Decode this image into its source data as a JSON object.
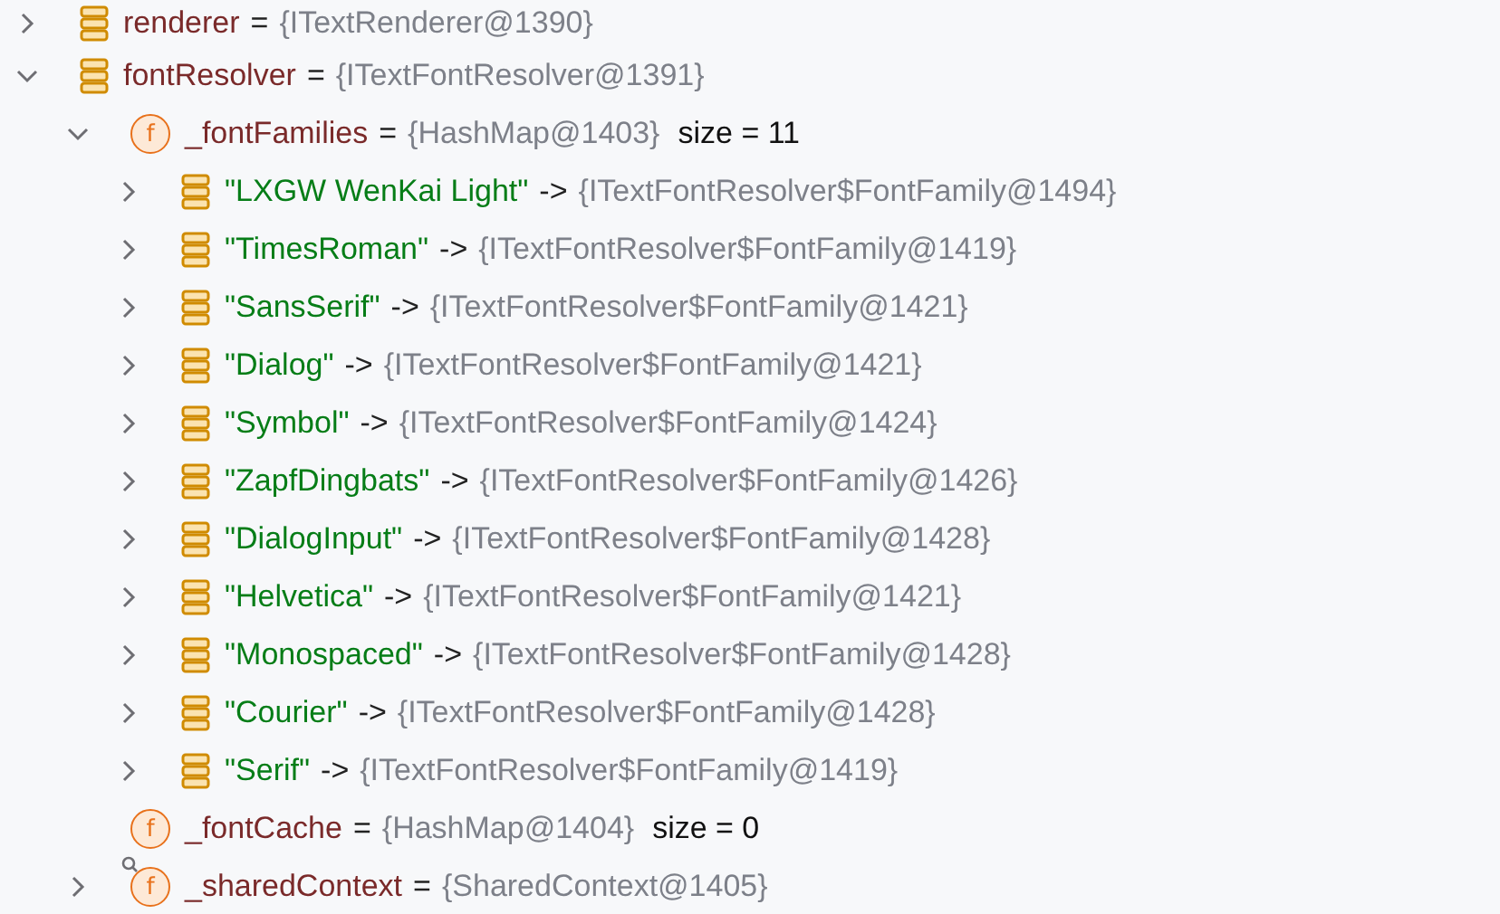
{
  "variables": [
    {
      "name": "renderer",
      "separator": "=",
      "value": "{ITextRenderer@1390}",
      "expanded": false
    },
    {
      "name": "fontResolver",
      "separator": "=",
      "value": "{ITextFontResolver@1391}",
      "expanded": true,
      "children": [
        {
          "name": "_fontFamilies",
          "separator": "=",
          "value": "{HashMap@1403}",
          "size": "size = 11",
          "kind": "field",
          "badge": "f",
          "expanded": true,
          "children": [
            {
              "key": "\"LXGW WenKai Light\"",
              "separator": "->",
              "value": "{ITextFontResolver$FontFamily@1494}",
              "expanded": false
            },
            {
              "key": "\"TimesRoman\"",
              "separator": "->",
              "value": "{ITextFontResolver$FontFamily@1419}",
              "expanded": false
            },
            {
              "key": "\"SansSerif\"",
              "separator": "->",
              "value": "{ITextFontResolver$FontFamily@1421}",
              "expanded": false
            },
            {
              "key": "\"Dialog\"",
              "separator": "->",
              "value": "{ITextFontResolver$FontFamily@1421}",
              "expanded": false
            },
            {
              "key": "\"Symbol\"",
              "separator": "->",
              "value": "{ITextFontResolver$FontFamily@1424}",
              "expanded": false
            },
            {
              "key": "\"ZapfDingbats\"",
              "separator": "->",
              "value": "{ITextFontResolver$FontFamily@1426}",
              "expanded": false
            },
            {
              "key": "\"DialogInput\"",
              "separator": "->",
              "value": "{ITextFontResolver$FontFamily@1428}",
              "expanded": false
            },
            {
              "key": "\"Helvetica\"",
              "separator": "->",
              "value": "{ITextFontResolver$FontFamily@1421}",
              "expanded": false
            },
            {
              "key": "\"Monospaced\"",
              "separator": "->",
              "value": "{ITextFontResolver$FontFamily@1428}",
              "expanded": false
            },
            {
              "key": "\"Courier\"",
              "separator": "->",
              "value": "{ITextFontResolver$FontFamily@1428}",
              "expanded": false
            },
            {
              "key": "\"Serif\"",
              "separator": "->",
              "value": "{ITextFontResolver$FontFamily@1419}",
              "expanded": false
            }
          ]
        },
        {
          "name": "_fontCache",
          "separator": "=",
          "value": "{HashMap@1404}",
          "size": "size = 0",
          "kind": "field",
          "badge": "f"
        },
        {
          "name": "_sharedContext",
          "separator": "=",
          "value": "{SharedContext@1405}",
          "kind": "field_linked",
          "badge": "f",
          "expanded": false
        }
      ]
    }
  ]
}
